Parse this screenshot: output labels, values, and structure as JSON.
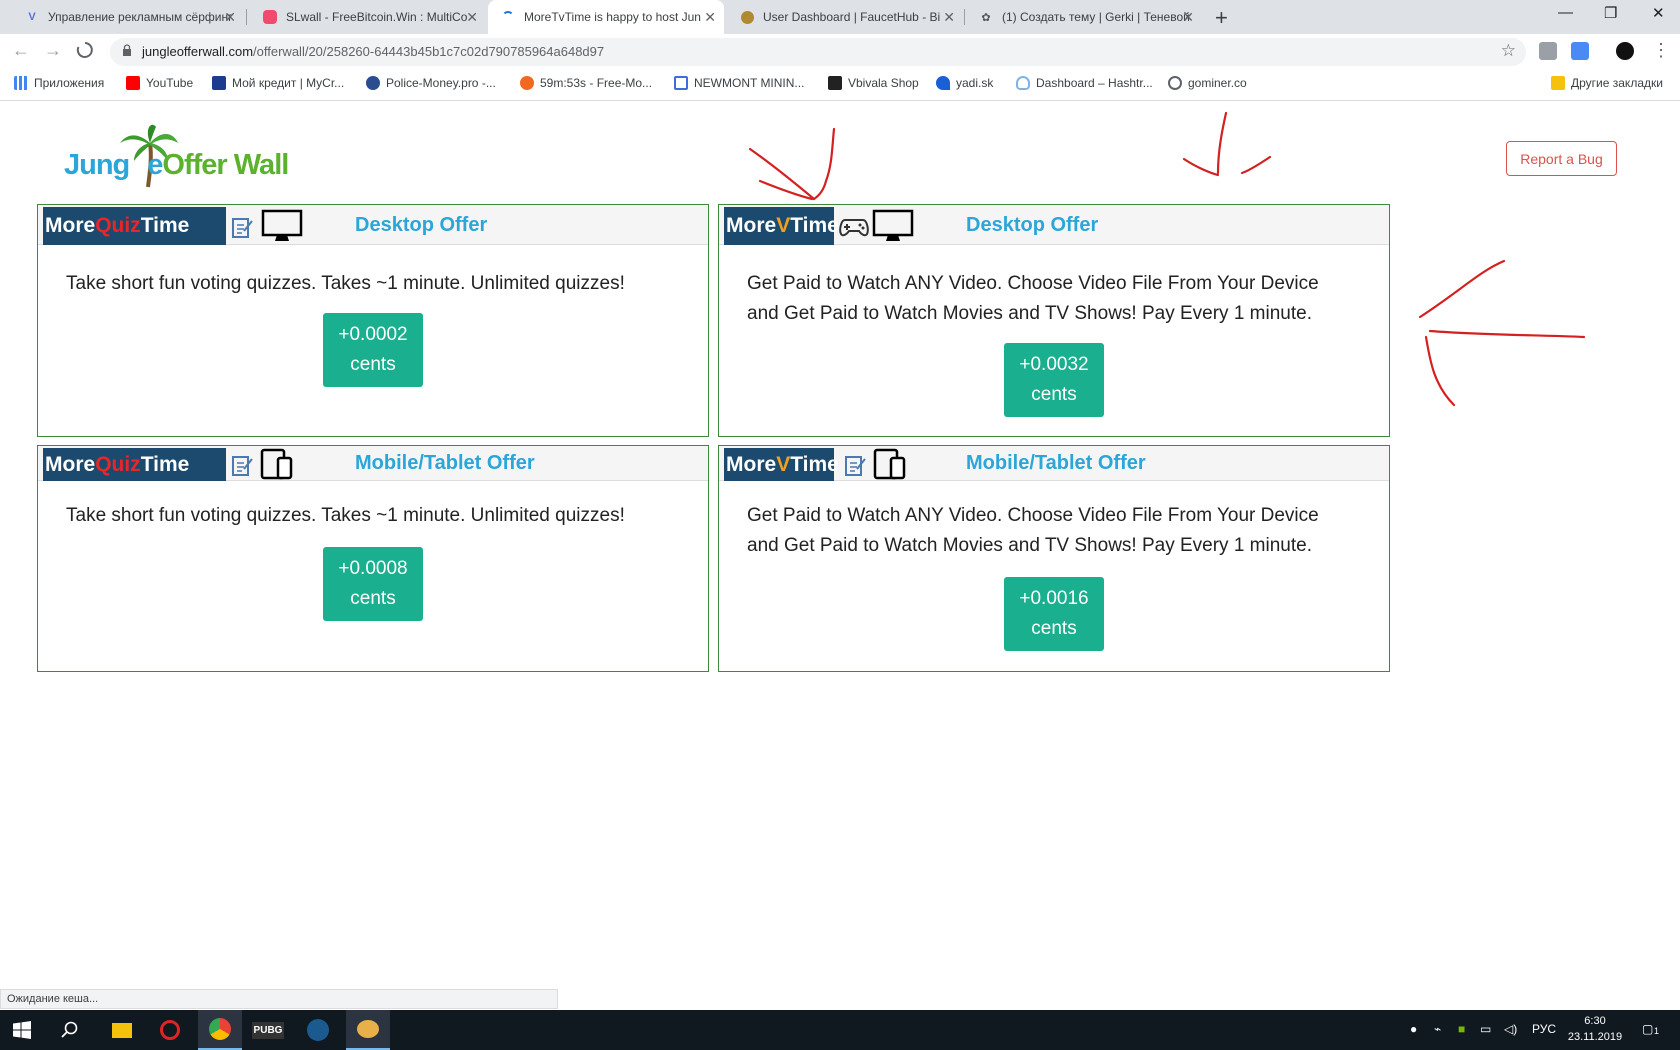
{
  "browser": {
    "tabs": [
      {
        "title": "Управление рекламным сёрфинг",
        "icon": "v-icon",
        "active": false
      },
      {
        "title": "SLwall - FreeBitcoin.Win : MultiCo",
        "icon": "slwall-icon",
        "active": false
      },
      {
        "title": "MoreTvTime is happy to host Jun",
        "icon": "loading-icon",
        "active": true
      },
      {
        "title": "User Dashboard | FaucetHub - Bi",
        "icon": "faucethub-icon",
        "active": false
      },
      {
        "title": "(1) Создать тему | Gerki | Теневой",
        "icon": "gerki-icon",
        "active": false
      }
    ],
    "url_domain": "jungleofferwall.com",
    "url_path": "/offerwall/20/258260-64443b45b1c7c02d790785964a648d97",
    "bookmarks": [
      {
        "label": "Приложения",
        "icon": "apps-icon"
      },
      {
        "label": "YouTube",
        "icon": "youtube-icon"
      },
      {
        "label": "Мой кредит | MyCr...",
        "icon": "mycredit-icon"
      },
      {
        "label": "Police-Money.pro -...",
        "icon": "policemoney-icon"
      },
      {
        "label": "59m:53s - Free-Mo...",
        "icon": "monero-icon"
      },
      {
        "label": "NEWMONT MININ...",
        "icon": "newmont-icon"
      },
      {
        "label": "Vbivala Shop",
        "icon": "vbivala-icon"
      },
      {
        "label": "yadi.sk",
        "icon": "yadisk-icon"
      },
      {
        "label": "Dashboard – Hashtr...",
        "icon": "hashtr-icon"
      },
      {
        "label": "gominer.co",
        "icon": "globe-icon"
      }
    ],
    "other_bookmarks": "Другие закладки",
    "status_text": "Ожидание кеша..."
  },
  "page": {
    "logo": {
      "part1": "Jung",
      "part2": "e",
      "part3": "Offer Wall"
    },
    "report_bug": "Report a Bug",
    "cards": [
      {
        "brand_a": "More",
        "brand_b": "Quiz",
        "brand_c": "Time",
        "label": "Desktop Offer",
        "desc_lines": [
          "Take short fun voting quizzes. Takes ~1 minute. Unlimited quizzes!"
        ],
        "amount": "+0.0002",
        "unit": "cents"
      },
      {
        "brand_a": "More",
        "brand_b": "V",
        "brand_c": "Time",
        "label": "Desktop Offer",
        "desc_lines": [
          "Get Paid to Watch ANY Video. Choose Video File From Your Device",
          "and Get Paid to Watch Movies and TV Shows! Pay Every 1 minute."
        ],
        "amount": "+0.0032",
        "unit": "cents"
      },
      {
        "brand_a": "More",
        "brand_b": "Quiz",
        "brand_c": "Time",
        "label": "Mobile/Tablet Offer",
        "desc_lines": [
          "Take short fun voting quizzes. Takes ~1 minute. Unlimited quizzes!"
        ],
        "amount": "+0.0008",
        "unit": "cents"
      },
      {
        "brand_a": "More",
        "brand_b": "V",
        "brand_c": "Time",
        "label": "Mobile/Tablet Offer",
        "desc_lines": [
          "Get Paid to Watch ANY Video. Choose Video File From Your Device",
          "and Get Paid to Watch Movies and TV Shows! Pay Every 1 minute."
        ],
        "amount": "+0.0016",
        "unit": "cents"
      }
    ]
  },
  "taskbar": {
    "lang": "РУС",
    "time": "6:30",
    "date": "23.11.2019",
    "notifications": "1"
  },
  "colors": {
    "brand_bg": "#1c4a6e",
    "offer_label": "#2ba6d8",
    "amount_button": "#1aaf8f",
    "card_border": "#3c8a3c",
    "report_bug": "#d9534f",
    "annotation_red": "#d42020"
  }
}
